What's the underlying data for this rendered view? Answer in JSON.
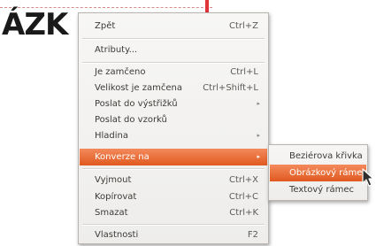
{
  "document": {
    "visible_text": "ÁZK"
  },
  "context_menu": {
    "items": [
      {
        "label": "Zpět",
        "shortcut": "Ctrl+Z"
      },
      {
        "label": "Atributy...",
        "shortcut": ""
      },
      {
        "label": "Je zamčeno",
        "shortcut": "Ctrl+L"
      },
      {
        "label": "Velikost je zamčena",
        "shortcut": "Ctrl+Shift+L"
      },
      {
        "label": "Poslat do výstřižků",
        "shortcut": ""
      },
      {
        "label": "Poslat do vzorků",
        "shortcut": ""
      },
      {
        "label": "Hladina",
        "shortcut": ""
      },
      {
        "label": "Konverze na",
        "shortcut": ""
      },
      {
        "label": "Vyjmout",
        "shortcut": "Ctrl+X"
      },
      {
        "label": "Kopírovat",
        "shortcut": "Ctrl+C"
      },
      {
        "label": "Smazat",
        "shortcut": "Ctrl+K"
      },
      {
        "label": "Vlastnosti",
        "shortcut": "F2"
      }
    ],
    "highlighted": "Konverze na",
    "highlight_color": "#e9662f"
  },
  "submenu": {
    "items": [
      {
        "label": "Beziérova křivka"
      },
      {
        "label": "Obrázkový rámec"
      },
      {
        "label": "Textový rámec"
      }
    ],
    "highlighted": "Obrázkový rámec"
  },
  "icons": {
    "submenu_arrow": "chevron-right-icon",
    "cursor": "mouse-pointer-icon"
  }
}
